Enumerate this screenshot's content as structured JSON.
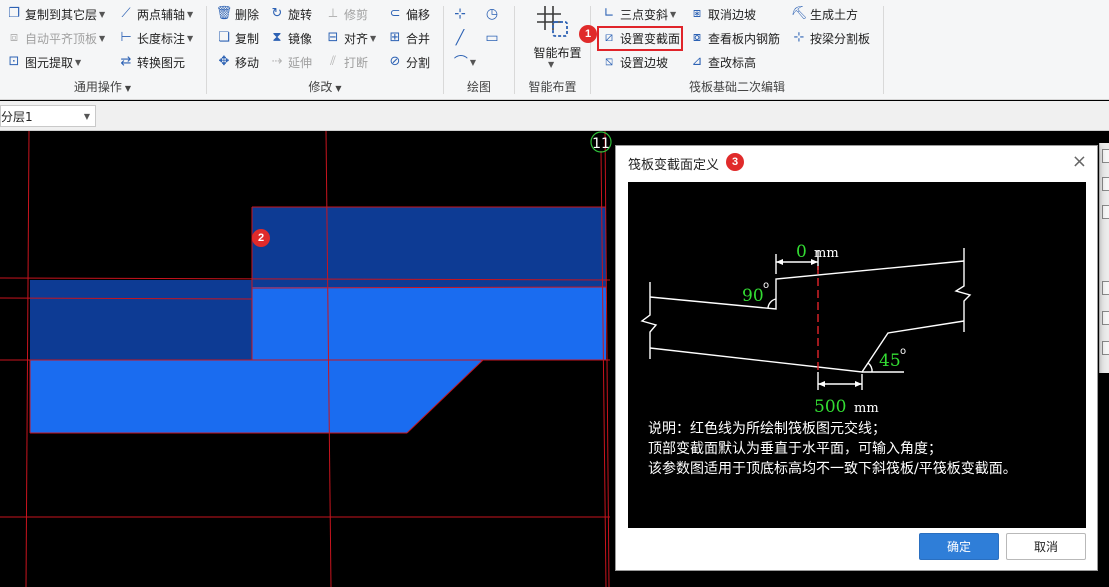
{
  "ribbon": {
    "general": {
      "copy_to_layer": "复制到其它层",
      "auto_align_top": "自动平齐顶板",
      "extract_element": "图元提取",
      "two_point_axis": "两点辅轴",
      "length_annotation": "长度标注",
      "convert_element": "转换图元",
      "group_label": "通用操作"
    },
    "modify": {
      "delete": "删除",
      "rotate": "旋转",
      "trim": "修剪",
      "offset": "偏移",
      "copy": "复制",
      "mirror": "镜像",
      "align": "对齐",
      "merge": "合并",
      "move": "移动",
      "extend": "延伸",
      "break": "打断",
      "split": "分割",
      "group_label": "修改"
    },
    "draw": {
      "group_label": "绘图"
    },
    "smart_layout": {
      "button": "智能布置",
      "group_label": "智能布置"
    },
    "raft_edit": {
      "three_point_slope": "三点变斜",
      "set_variable_section": "设置变截面",
      "set_edge_slope": "设置边坡",
      "cancel_edge_slope": "取消边坡",
      "view_plate_rebar": "查看板内钢筋",
      "change_elevation": "查改标高",
      "generate_earthwork": "生成土方",
      "split_by_beam": "按梁分割板",
      "group_label": "筏板基础二次编辑"
    }
  },
  "layer_bar": {
    "selected_layer": "分层1"
  },
  "canvas": {
    "axis_label": "11"
  },
  "badges": {
    "b1": "1",
    "b2": "2",
    "b3": "3"
  },
  "dialog": {
    "title": "筏板变截面定义",
    "close_icon": "×",
    "figure": {
      "top_value": "0",
      "top_unit": "mm",
      "top_angle": "90",
      "bottom_angle": "45",
      "bottom_value": "500",
      "bottom_unit": "mm"
    },
    "notes": [
      "说明：红色线为所绘制筏板图元交线；",
      "顶部变截面默认为垂直于水平面，可输入角度；",
      "该参数图适用于顶底标高均不一致下斜筏板/平筏板变截面。"
    ],
    "ok_label": "确定",
    "cancel_label": "取消"
  },
  "colors": {
    "dark_slab": "#0d3b94",
    "light_slab": "#1a6cf0",
    "grid_line": "#c8141e",
    "dimension_green": "#33dd33",
    "highlight": "#e0242a",
    "badge": "#e02b2b",
    "ok_button": "#2f7ed8"
  }
}
